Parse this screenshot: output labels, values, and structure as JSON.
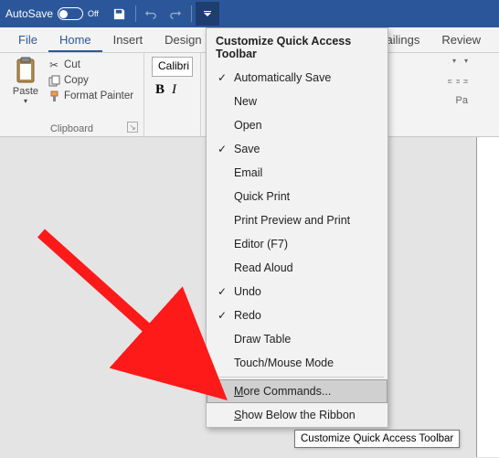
{
  "titlebar": {
    "autosave_label": "AutoSave",
    "autosave_state": "Off"
  },
  "tabs": {
    "file": "File",
    "home": "Home",
    "insert": "Insert",
    "design": "Design",
    "mailings": "Mailings",
    "review": "Review"
  },
  "clipboard": {
    "paste": "Paste",
    "cut": "Cut",
    "copy": "Copy",
    "format_painter": "Format Painter",
    "group_label": "Clipboard"
  },
  "font": {
    "name": "Calibri (B",
    "bold": "B",
    "italic": "I"
  },
  "paragraph_hint": "Pa",
  "menu": {
    "title": "Customize Quick Access Toolbar",
    "items": [
      {
        "label": "Automatically Save",
        "checked": true
      },
      {
        "label": "New",
        "checked": false
      },
      {
        "label": "Open",
        "checked": false
      },
      {
        "label": "Save",
        "checked": true
      },
      {
        "label": "Email",
        "checked": false
      },
      {
        "label": "Quick Print",
        "checked": false
      },
      {
        "label": "Print Preview and Print",
        "checked": false
      },
      {
        "label": "Editor (F7)",
        "checked": false
      },
      {
        "label": "Read Aloud",
        "checked": false
      },
      {
        "label": "Undo",
        "checked": true
      },
      {
        "label": "Redo",
        "checked": true
      },
      {
        "label": "Draw Table",
        "checked": false
      },
      {
        "label": "Touch/Mouse Mode",
        "checked": false
      }
    ],
    "more_commands": "More Commands...",
    "show_below": "Show Below the Ribbon"
  },
  "tooltip": "Customize Quick Access Toolbar"
}
